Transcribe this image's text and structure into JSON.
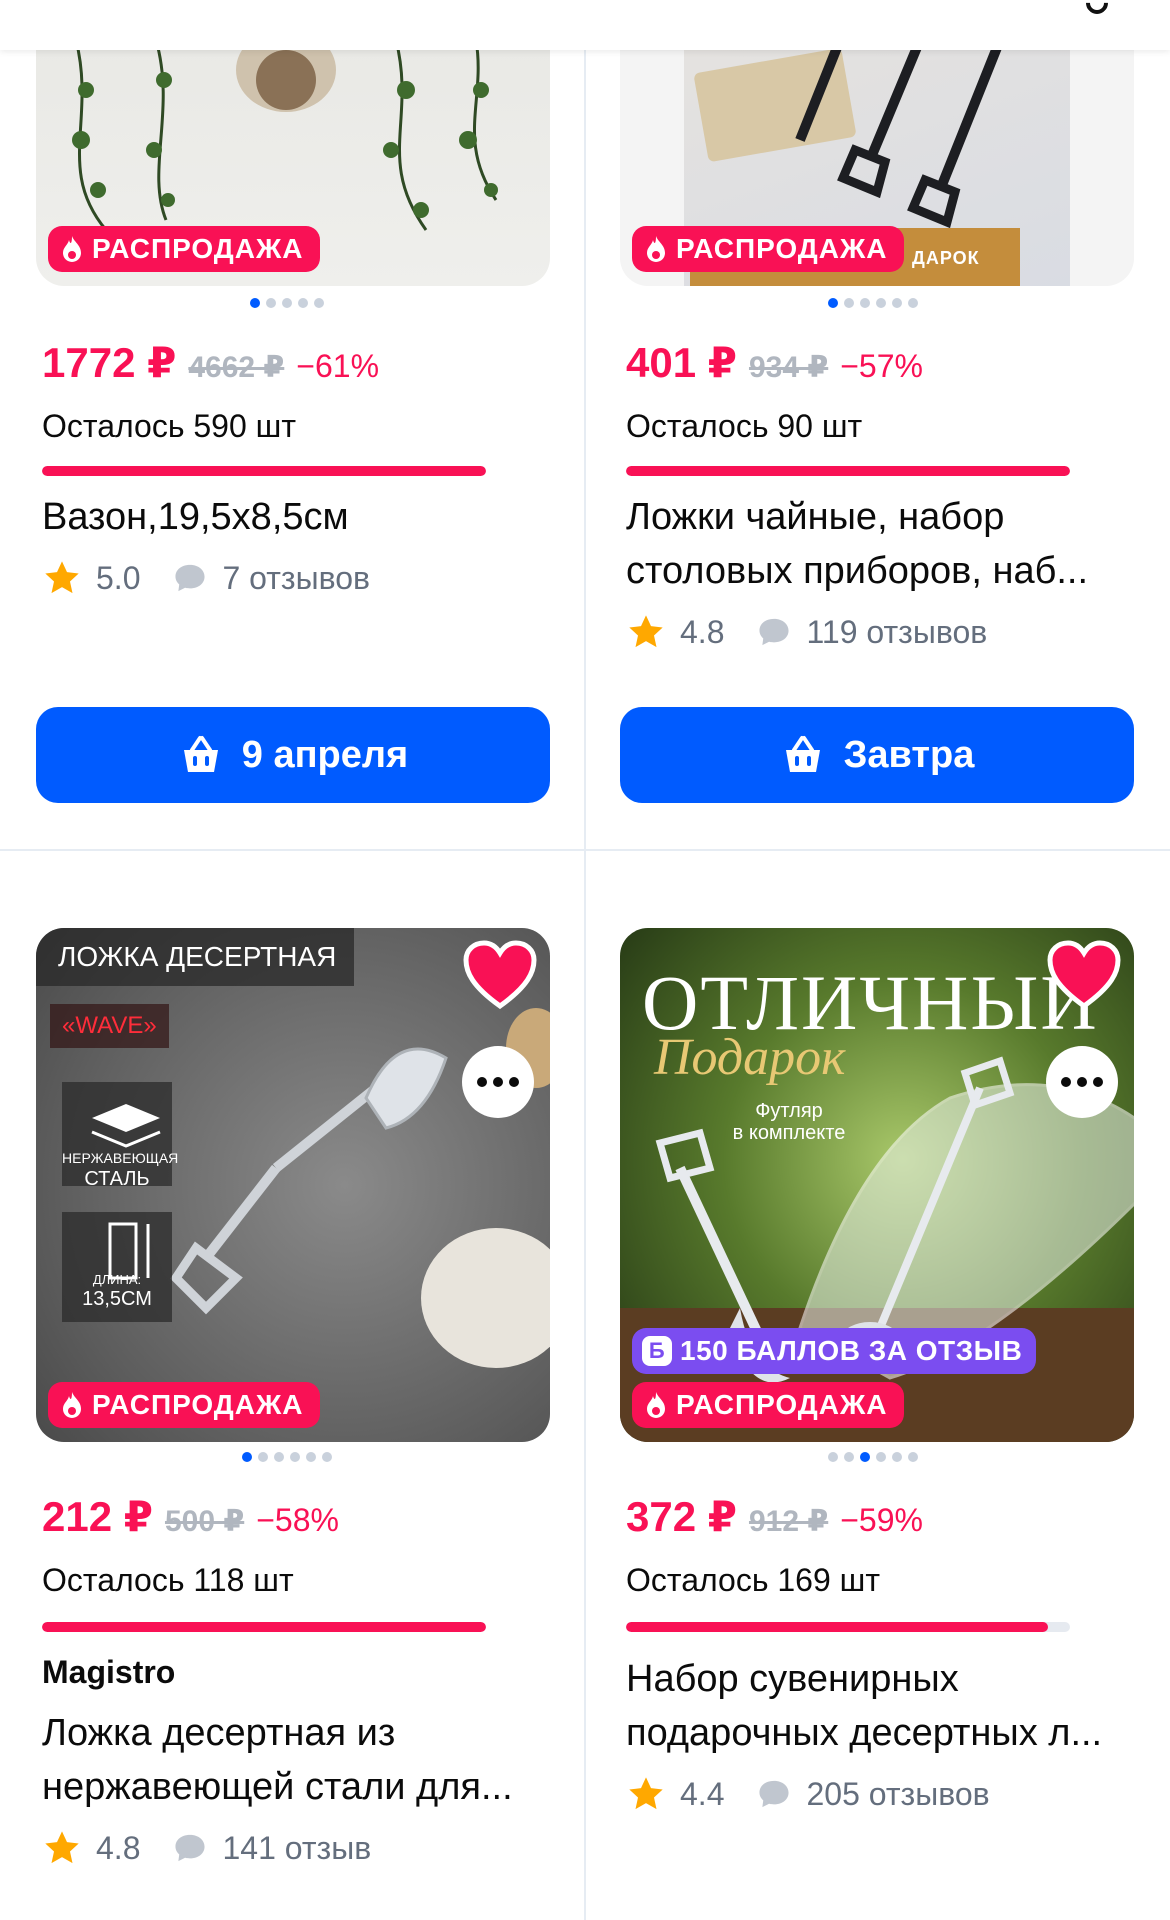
{
  "colors": {
    "accent": "#005bff",
    "sale": "#f91155",
    "points": "#7b4df0"
  },
  "products": [
    {
      "badge": "РАСПРОДАЖА",
      "price": "1772 ₽",
      "old_price": "4662 ₽",
      "discount": "−61%",
      "remaining": "Осталось 590 шт",
      "stock_fraction": 0.86,
      "title": "Вазон,19,5х8,5см",
      "rating": "5.0",
      "reviews": "7 отзывов",
      "button": "9 апреля",
      "image_dots": 5,
      "active_dot": 0
    },
    {
      "badge": "РАСПРОДАЖА",
      "price": "401 ₽",
      "old_price": "934 ₽",
      "discount": "−57%",
      "remaining": "Осталось 90 шт",
      "stock_fraction": 0.86,
      "title": "Ложки чайные, набор столовых приборов, наб...",
      "rating": "4.8",
      "reviews": "119 отзывов",
      "button": "Завтра",
      "image_dots": 6,
      "active_dot": 0,
      "image_text": "ДАРОК"
    },
    {
      "badge": "РАСПРОДАЖА",
      "price": "212 ₽",
      "old_price": "500 ₽",
      "discount": "−58%",
      "remaining": "Осталось 118 шт",
      "stock_fraction": 0.86,
      "brand": "Magistro",
      "title": "Ложка десертная из нержавеющей стали для...",
      "rating": "4.8",
      "reviews": "141 отзыв",
      "image_dots": 6,
      "active_dot": 0,
      "image_texts": {
        "headline": "ЛОЖКА ДЕСЕРТНАЯ",
        "series": "«WAVE»",
        "steel_1": "НЕРЖАВЕЮЩАЯ",
        "steel_2": "СТАЛЬ",
        "length_1": "ДЛИНА:",
        "length_2": "13,5СМ"
      }
    },
    {
      "badge": "РАСПРОДАЖА",
      "points_badge": "150 БАЛЛОВ ЗА ОТЗЫВ",
      "points_icon": "Б",
      "price": "372 ₽",
      "old_price": "912 ₽",
      "discount": "−59%",
      "remaining": "Осталось 169 шт",
      "stock_fraction": 0.84,
      "title": "Набор сувенирных подарочных десертных л...",
      "rating": "4.4",
      "reviews": "205 отзывов",
      "image_dots": 6,
      "active_dot": 2,
      "image_texts": {
        "headline": "ОТЛИЧНЫЙ",
        "script": "Подарок",
        "case_1": "Футляр",
        "case_2": "в комплекте"
      }
    }
  ]
}
